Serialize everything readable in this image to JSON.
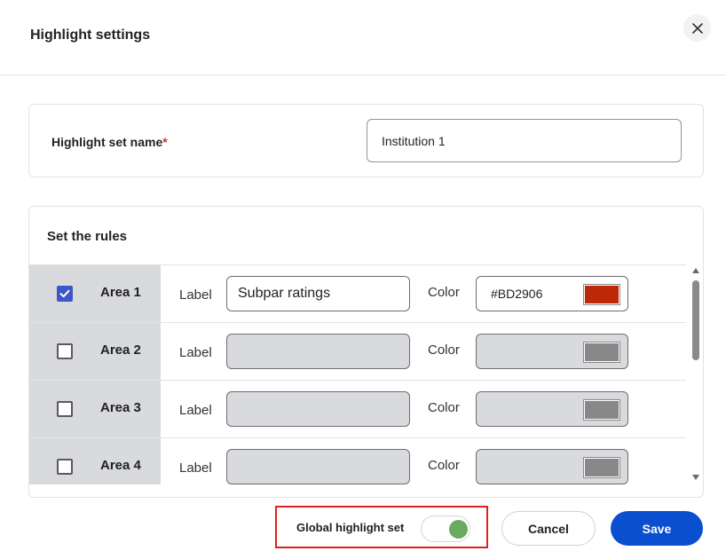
{
  "dialog": {
    "title": "Highlight settings"
  },
  "name_section": {
    "label": "Highlight set name",
    "required_mark": "*",
    "value": "Institution 1"
  },
  "rules": {
    "title": "Set the rules",
    "label_text": "Label",
    "color_text": "Color",
    "items": [
      {
        "area": "Area 1",
        "checked": true,
        "label_value": "Subpar ratings",
        "color_value": "#BD2906",
        "swatch": "#BD2906"
      },
      {
        "area": "Area 2",
        "checked": false,
        "label_value": "",
        "color_value": "",
        "swatch": "#888888"
      },
      {
        "area": "Area 3",
        "checked": false,
        "label_value": "",
        "color_value": "",
        "swatch": "#888888"
      },
      {
        "area": "Area 4",
        "checked": false,
        "label_value": "",
        "color_value": "",
        "swatch": "#888888"
      }
    ]
  },
  "footer": {
    "global_label": "Global highlight set",
    "global_enabled": true,
    "toggle_color": "#6aa95e",
    "cancel_label": "Cancel",
    "save_label": "Save",
    "save_color": "#0a4fcf"
  },
  "icons": {
    "close": "close-icon",
    "check": "check-icon"
  }
}
